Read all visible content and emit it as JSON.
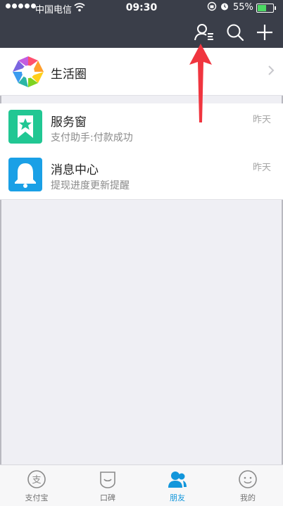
{
  "status": {
    "carrier": "中国电信",
    "time": "09:30",
    "battery_pct": "55%",
    "battery_level": 0.55
  },
  "list": {
    "life_circle": {
      "title": "生活圈"
    },
    "items": [
      {
        "title": "服务窗",
        "subtitle": "支付助手:付款成功",
        "time": "昨天",
        "color": "#21c793"
      },
      {
        "title": "消息中心",
        "subtitle": "提现进度更新提醒",
        "time": "昨天",
        "color": "#1aa0e6"
      }
    ]
  },
  "tabs": [
    {
      "label": "支付宝"
    },
    {
      "label": "口碑"
    },
    {
      "label": "朋友",
      "active": true
    },
    {
      "label": "我的"
    }
  ],
  "colors": {
    "nav_bg": "#3a3e49",
    "accent": "#1296db",
    "arrow": "#f0353f"
  }
}
